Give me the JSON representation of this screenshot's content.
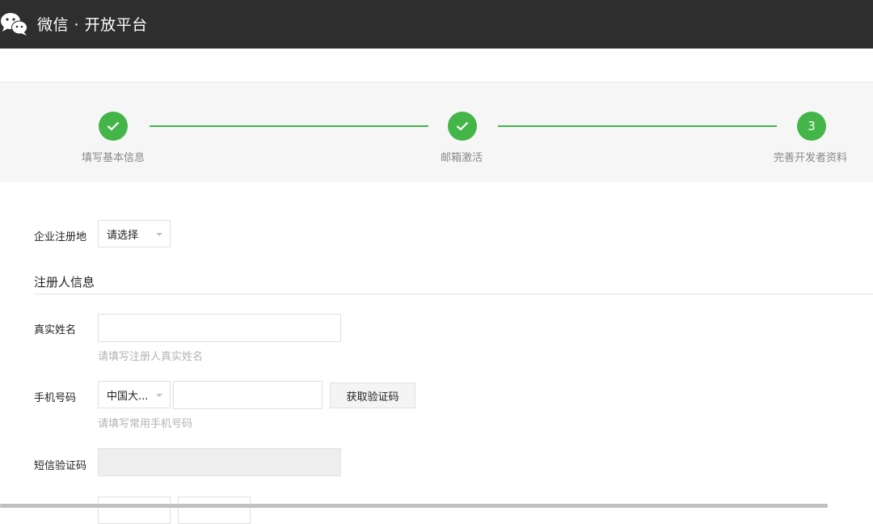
{
  "header": {
    "brand": "微信 · 开放平台",
    "logo_icon": "wechat-logo-icon"
  },
  "steps": [
    {
      "label": "填写基本信息",
      "status": "done",
      "icon": "check-icon"
    },
    {
      "label": "邮箱激活",
      "status": "done",
      "icon": "check-icon"
    },
    {
      "label": "完善开发者资料",
      "status": "current",
      "number": "3"
    }
  ],
  "form": {
    "region": {
      "label": "企业注册地",
      "selected": "请选择"
    },
    "registrant_section_title": "注册人信息",
    "real_name": {
      "label": "真实姓名",
      "value": "",
      "hint": "请填写注册人真实姓名"
    },
    "phone": {
      "label": "手机号码",
      "country_selected": "中国大...",
      "value": "",
      "get_code_button": "获取验证码",
      "hint": "请填写常用手机号码"
    },
    "sms_code": {
      "label": "短信验证码",
      "value": ""
    }
  },
  "colors": {
    "accent": "#44b549",
    "topbar": "#2e2e2e",
    "steps_bg": "#f6f6f6"
  }
}
